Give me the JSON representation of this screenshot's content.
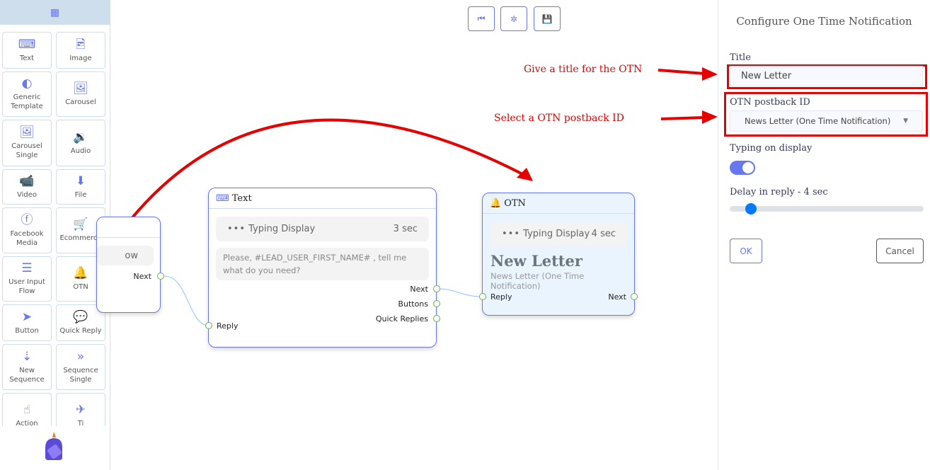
{
  "sidebar": {
    "header_icon": "grid-icon",
    "items": [
      {
        "label": "Text",
        "icon": "keyboard-icon"
      },
      {
        "label": "Image",
        "icon": "file-image-icon"
      },
      {
        "label": "Generic Template",
        "icon": "half-circle-icon"
      },
      {
        "label": "Carousel",
        "icon": "images-icon"
      },
      {
        "label": "Carousel Single",
        "icon": "image-icon"
      },
      {
        "label": "Audio",
        "icon": "file-audio-icon"
      },
      {
        "label": "Video",
        "icon": "file-video-icon"
      },
      {
        "label": "File",
        "icon": "file-download-icon"
      },
      {
        "label": "Facebook Media",
        "icon": "facebook-icon"
      },
      {
        "label": "Ecommerce",
        "icon": "cart-plus-icon"
      },
      {
        "label": "User Input Flow",
        "icon": "bars-icon"
      },
      {
        "label": "OTN",
        "icon": "bell-icon"
      },
      {
        "label": "Button",
        "icon": "paper-plane-icon"
      },
      {
        "label": "Quick Reply",
        "icon": "comment-dots-icon"
      },
      {
        "label": "New Sequence",
        "icon": "sort-numeric-icon"
      },
      {
        "label": "Sequence Single",
        "icon": "angle-double-right-icon"
      },
      {
        "label": "Action",
        "icon": "hand-pointer-icon"
      },
      {
        "label": "Ti",
        "icon": "plane-departure-icon"
      }
    ]
  },
  "toolbar": {
    "buttons": [
      {
        "icon": "step-backward-icon"
      },
      {
        "icon": "compress-icon"
      },
      {
        "icon": "save-icon"
      }
    ]
  },
  "nodes": {
    "partial": {
      "text": "ow",
      "next": "Next"
    },
    "text": {
      "title": "Text",
      "typing_label": "Typing Display",
      "typing_delay": "3 sec",
      "message": "Please, #LEAD_USER_FIRST_NAME# , tell me what do you need?",
      "reply": "Reply",
      "outputs": [
        "Next",
        "Buttons",
        "Quick Replies"
      ]
    },
    "otn": {
      "title": "OTN",
      "typing_label": "Typing Display",
      "typing_delay": "4 sec",
      "heading": "New Letter",
      "subheading": "News Letter (One Time Notification)",
      "reply": "Reply",
      "next": "Next"
    }
  },
  "annotations": {
    "title_hint": "Give a title for the OTN",
    "postback_hint": "Select a OTN postback ID",
    "color": "#e60000"
  },
  "panel": {
    "heading": "Configure One Time Notification",
    "title_label": "Title",
    "title_value": "New Letter",
    "postback_label": "OTN postback ID",
    "postback_value": "News Letter (One Time Notification)",
    "typing_label": "Typing on display",
    "typing_on": true,
    "delay_label": "Delay in reply  -  4 sec",
    "delay_value": 4,
    "ok": "OK",
    "cancel": "Cancel"
  },
  "colors": {
    "accent": "#6777ef",
    "port": "#6ab04c",
    "slider": "#007bff"
  }
}
